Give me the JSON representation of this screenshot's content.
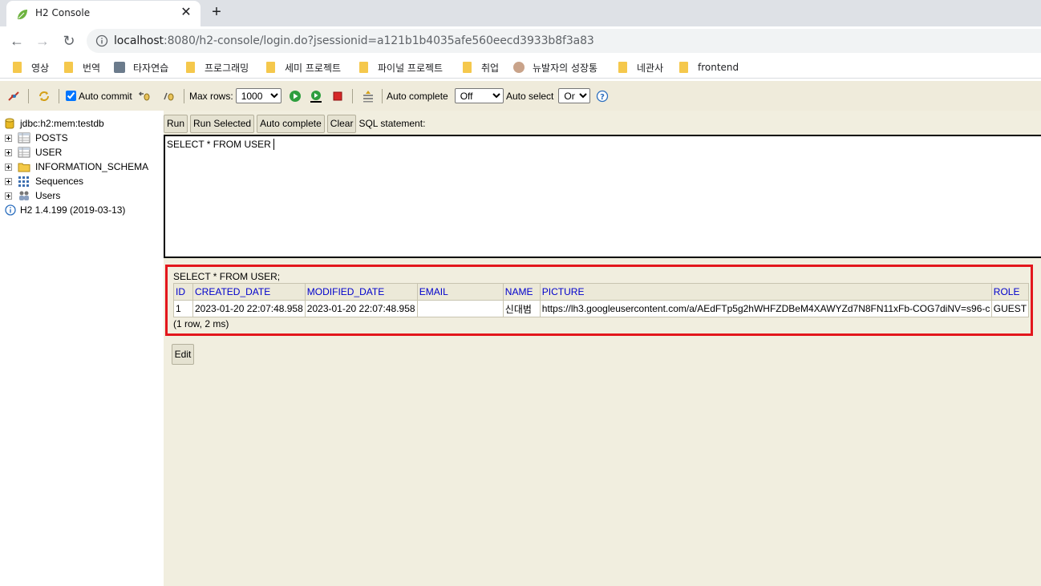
{
  "browser": {
    "tab_title": "H2 Console",
    "tab_close": "✕",
    "new_tab": "+",
    "back": "←",
    "forward": "→",
    "reload": "↻",
    "url_host": "localhost",
    "url_rest": ":8080/h2-console/login.do?jsessionid=a121b1b4035afe560eecd3933b8f3a83",
    "bookmarks": [
      {
        "label": "영상",
        "icon": "folder-icon"
      },
      {
        "label": "번역",
        "icon": "folder-icon"
      },
      {
        "label": "타자연습",
        "icon": "site-favicon"
      },
      {
        "label": "프로그래밍",
        "icon": "folder-icon"
      },
      {
        "label": "세미 프로젝트",
        "icon": "folder-icon"
      },
      {
        "label": "파이널 프로젝트",
        "icon": "folder-icon"
      },
      {
        "label": "취업",
        "icon": "folder-icon"
      },
      {
        "label": "뉴발자의 성장통",
        "icon": "site-favicon"
      },
      {
        "label": "네관사",
        "icon": "folder-icon"
      },
      {
        "label": "frontend",
        "icon": "folder-icon"
      }
    ]
  },
  "toolbar": {
    "auto_commit_label": "Auto commit",
    "auto_commit_checked": true,
    "max_rows_label": "Max rows:",
    "max_rows_value": "1000",
    "auto_complete_label": "Auto complete",
    "auto_complete_value": "Off",
    "auto_select_label": "Auto select",
    "auto_select_value": "On"
  },
  "tree": {
    "connection": "jdbc:h2:mem:testdb",
    "items": [
      "POSTS",
      "USER",
      "INFORMATION_SCHEMA",
      "Sequences",
      "Users"
    ],
    "version": "H2 1.4.199 (2019-03-13)"
  },
  "sql": {
    "buttons": {
      "run": "Run",
      "run_selected": "Run Selected",
      "auto_complete": "Auto complete",
      "clear": "Clear"
    },
    "statement_label": "SQL statement:",
    "text": "SELECT * FROM USER"
  },
  "result": {
    "query": "SELECT * FROM USER;",
    "columns": [
      "ID",
      "CREATED_DATE",
      "MODIFIED_DATE",
      "EMAIL",
      "NAME",
      "PICTURE",
      "ROLE"
    ],
    "rows": [
      [
        "1",
        "2023-01-20 22:07:48.958",
        "2023-01-20 22:07:48.958",
        "",
        "신대범",
        "https://lh3.googleusercontent.com/a/AEdFTp5g2hWHFZDBeM4XAWYZd7N8FN11xFb-COG7diNV=s96-c",
        "GUEST"
      ]
    ],
    "footer": "(1 row, 2 ms)",
    "edit_label": "Edit"
  },
  "colors": {
    "highlight_border": "#e3161c",
    "column_header": "#0000cc",
    "panel_bg": "#f1eedf"
  }
}
